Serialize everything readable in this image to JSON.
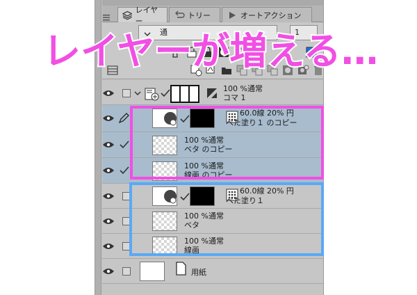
{
  "annotation": {
    "text": "レイヤーが増える…",
    "color": "#f14fe4"
  },
  "tabs": [
    {
      "label": "レイヤー",
      "icon": "layers-icon"
    },
    {
      "label": "トリー",
      "icon": "history-icon"
    },
    {
      "label": "オートアクション",
      "icon": "auto-action-icon"
    }
  ],
  "blend": {
    "mode": "通",
    "opacity": "1"
  },
  "layers": {
    "folder": {
      "line1": "100 %通常",
      "line2": "コマ 1"
    },
    "copy_group": [
      {
        "line1": "60.0線 20% 円",
        "line2": "べた塗り１ のコピー"
      },
      {
        "line1": "100 %通常",
        "line2": "ベタ のコピー"
      },
      {
        "line1": "100 %通常",
        "line2": "線画 のコピー"
      }
    ],
    "orig_group": [
      {
        "line1": "60.0線 20% 円",
        "line2": "べた塗り１"
      },
      {
        "line1": "100 %通常",
        "line2": "ベタ"
      },
      {
        "line1": "100 %通常",
        "line2": "線画"
      }
    ],
    "paper": {
      "label": "用紙"
    }
  },
  "colors": {
    "highlight_copy": "#f14fe4",
    "highlight_original": "#5aa9f5",
    "selected_row": "#a8bccd"
  }
}
